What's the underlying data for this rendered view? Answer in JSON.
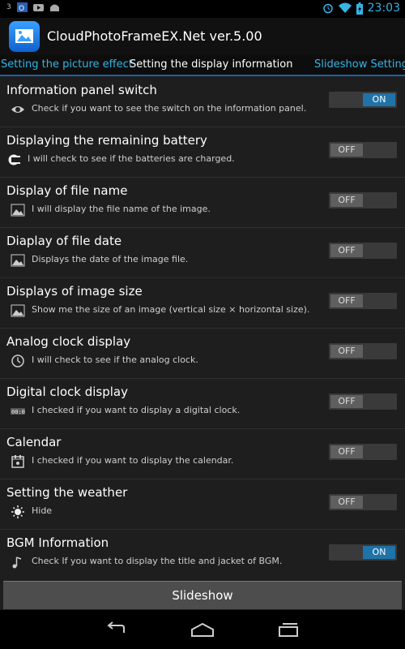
{
  "status": {
    "left_num": "3",
    "time": "23:03",
    "icons": [
      "outlook-icon",
      "game-icon",
      "android-icon",
      "alarm-icon",
      "wifi-icon",
      "battery-icon"
    ]
  },
  "app": {
    "title": "CloudPhotoFrameEX.Net  ver.5.00",
    "icon": "photo-frame-app-icon"
  },
  "tabs": [
    {
      "label": "Setting the picture effect",
      "active": false
    },
    {
      "label": "Setting the display information",
      "active": true
    },
    {
      "label": "Slideshow Settings",
      "active": false
    }
  ],
  "settings": [
    {
      "title": "Information panel switch",
      "desc": "Check if you want to see the switch on the information panel.",
      "icon": "eye-icon",
      "state": "ON"
    },
    {
      "title": "Displaying the remaining battery",
      "desc": "I will check to see if the batteries are charged.",
      "icon": "battery-plug-icon",
      "state": "OFF"
    },
    {
      "title": "Display of file name",
      "desc": "I will display the file name of the image.",
      "icon": "picture-icon",
      "state": "OFF"
    },
    {
      "title": "Diaplay of file date",
      "desc": "Displays the date of the image file.",
      "icon": "picture-icon",
      "state": "OFF"
    },
    {
      "title": "Displays of image size",
      "desc": "Show me the size of an image (vertical size × horizontal size).",
      "icon": "picture-icon",
      "state": "OFF"
    },
    {
      "title": "Analog clock display",
      "desc": "I will check to see if the analog clock.",
      "icon": "analog-clock-icon",
      "state": "OFF"
    },
    {
      "title": "Digital clock display",
      "desc": "I checked if you want to display a digital clock.",
      "icon": "digital-clock-icon",
      "state": "OFF"
    },
    {
      "title": "Calendar",
      "desc": "I checked if you want to display the calendar.",
      "icon": "calendar-icon",
      "state": "OFF"
    },
    {
      "title": "Setting the weather",
      "desc": "Hide",
      "icon": "sun-icon",
      "state": "OFF"
    },
    {
      "title": "BGM Information",
      "desc": "Check If you want to display the title and jacket of BGM.",
      "icon": "music-icon",
      "state": "ON"
    }
  ],
  "bottom": {
    "slideshow_label": "Slideshow"
  },
  "nav": [
    "back-icon",
    "home-icon",
    "recent-apps-icon"
  ],
  "colors": {
    "accent": "#33b5e5",
    "toggle_on": "#1f73a8"
  }
}
